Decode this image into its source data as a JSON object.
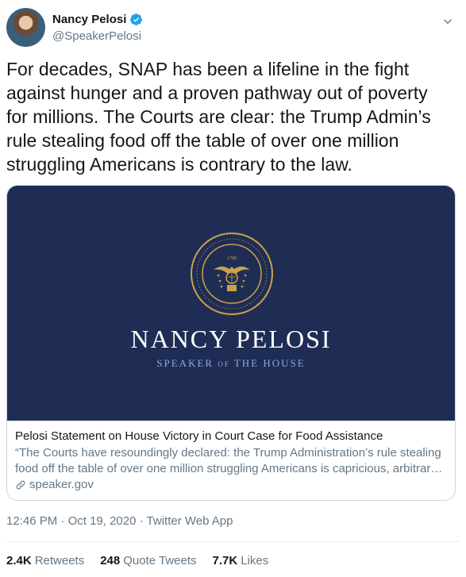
{
  "author": {
    "display_name": "Nancy Pelosi",
    "handle": "@SpeakerPelosi",
    "verified": true
  },
  "tweet": {
    "text": "For decades, SNAP has been a lifeline in the fight\nagainst hunger and a proven pathway out of poverty\nfor millions. The Courts are clear: the Trump Admin’s\nrule stealing food off the table of over one million\nstruggling Americans is contrary to the law."
  },
  "card": {
    "brand_name": "NANCY PELOSI",
    "brand_sub_1": "SPEAKER",
    "brand_sub_of": "OF",
    "brand_sub_2": "THE HOUSE",
    "seal_year": "1789",
    "title": "Pelosi Statement on House Victory in Court Case for Food Assistance",
    "description": "“The Courts have resoundingly declared: the Trump Administration’s rule stealing food off the table of over one million struggling Americans is capricious, arbitrary and contrary to the law.”",
    "domain": "speaker.gov"
  },
  "meta": {
    "time": "12:46 PM",
    "date": "Oct 19, 2020",
    "source": "Twitter Web App",
    "separator": "·"
  },
  "stats": {
    "retweets_count": "2.4K",
    "retweets_label": "Retweets",
    "quotes_count": "248",
    "quotes_label": "Quote Tweets",
    "likes_count": "7.7K",
    "likes_label": "Likes"
  },
  "colors": {
    "card_background": "#1f2d55",
    "seal_gold": "#c9a24a",
    "verified_blue": "#1da1f2",
    "secondary_text": "#657786"
  },
  "icons": [
    "verified-badge-icon",
    "more-chevron-icon",
    "link-icon"
  ]
}
